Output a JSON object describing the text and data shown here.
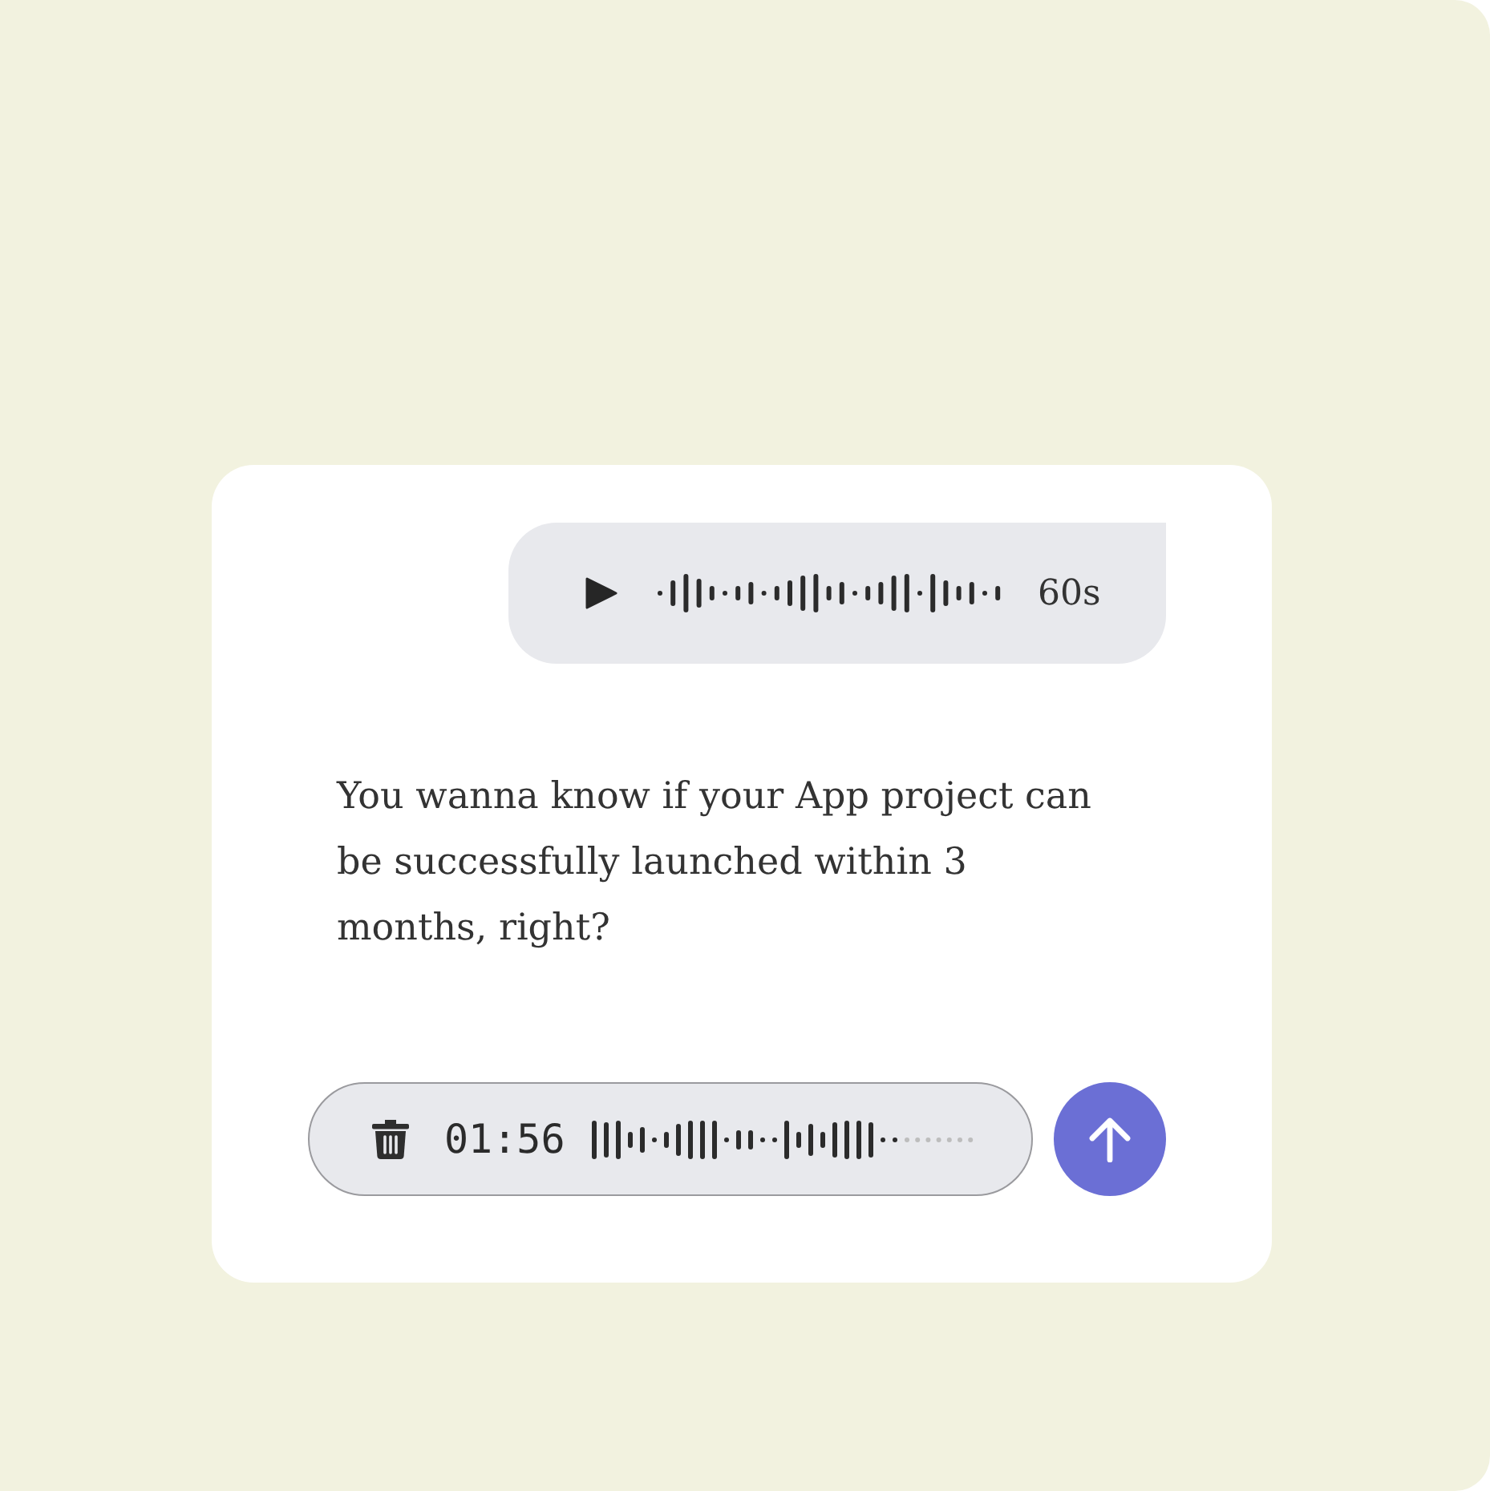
{
  "voice_message": {
    "duration": "60s"
  },
  "message": {
    "text": "You wanna know if your App project can be successfully launched within 3 months, right?"
  },
  "recorder": {
    "time": "01:56"
  }
}
